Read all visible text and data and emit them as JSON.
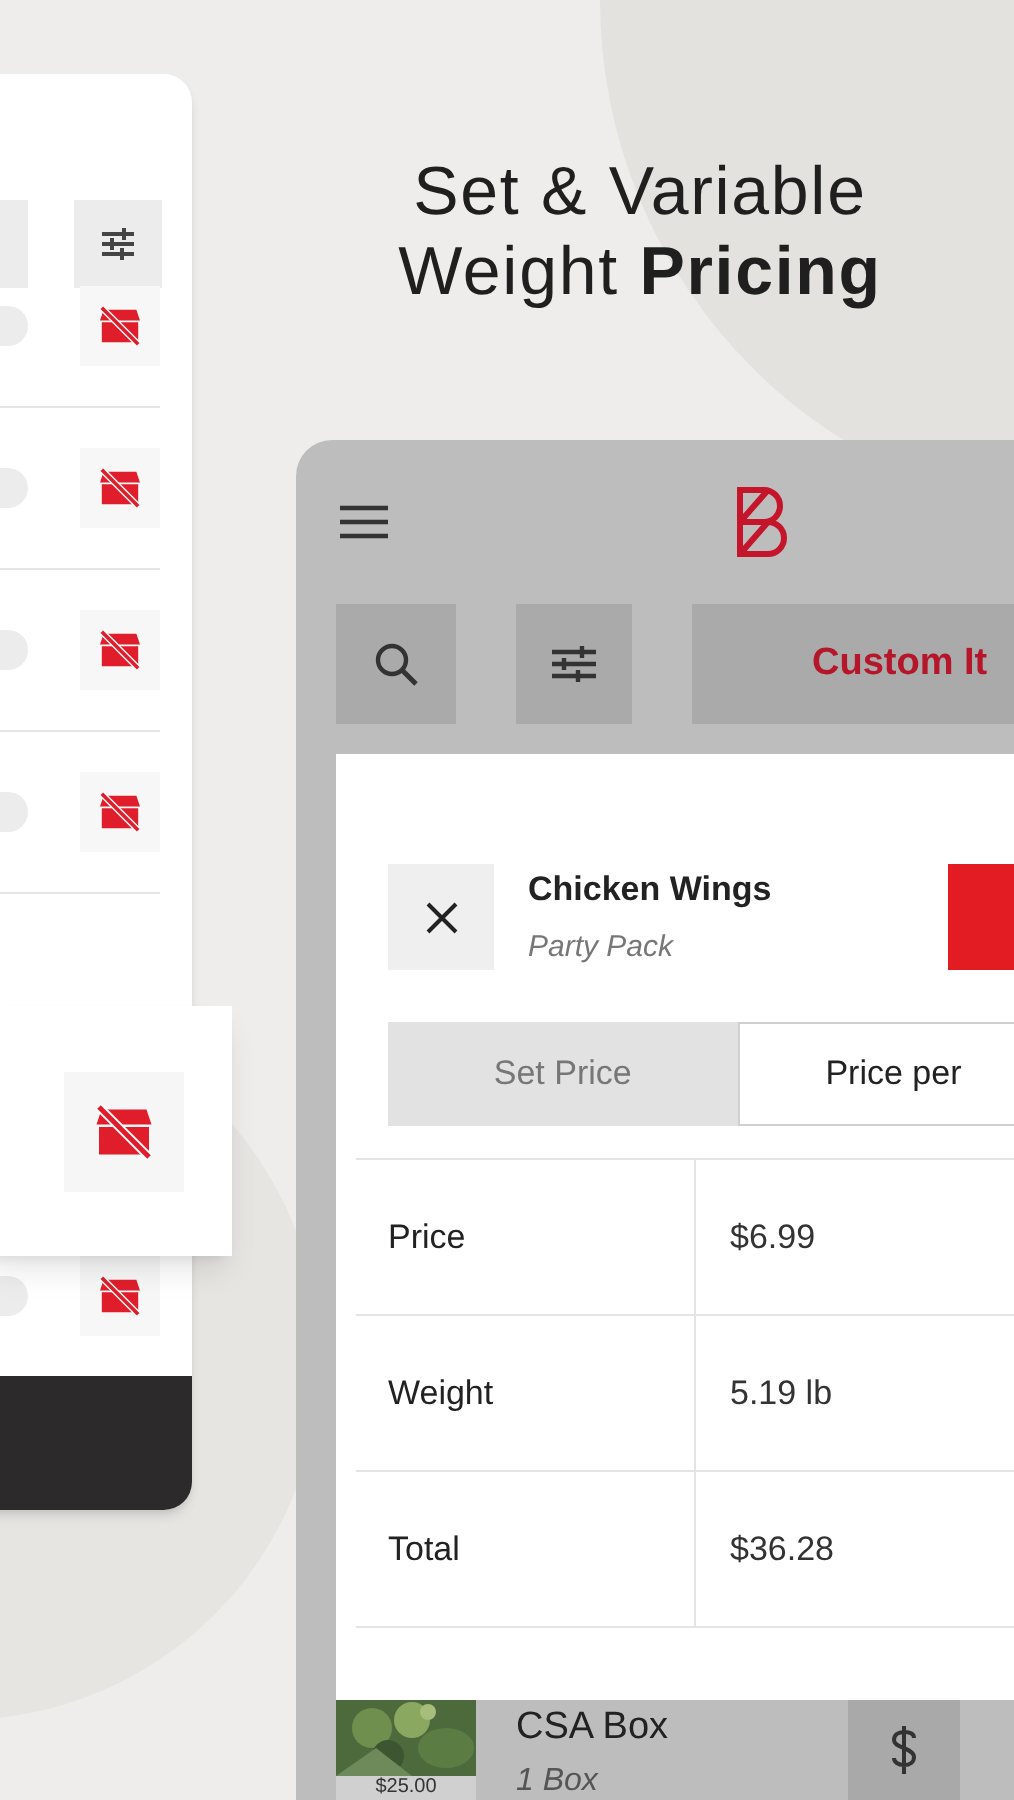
{
  "headline": {
    "line1": "Set & Variable",
    "line2": "Weight **Pricing**"
  },
  "app": {
    "custom_button": "Custom It",
    "modal": {
      "title": "Chicken Wings",
      "subtitle": "Party Pack",
      "tabs": [
        {
          "label": "Set Price",
          "selected": false
        },
        {
          "label": "Price per",
          "selected": true
        }
      ],
      "rows": [
        {
          "label": "Price",
          "value": "$6.99"
        },
        {
          "label": "Weight",
          "value": "5.19 lb"
        },
        {
          "label": "Total",
          "value": "$36.28"
        }
      ]
    },
    "list_item": {
      "name": "CSA Box",
      "quantity": "1 Box",
      "price": "$25.00"
    }
  }
}
